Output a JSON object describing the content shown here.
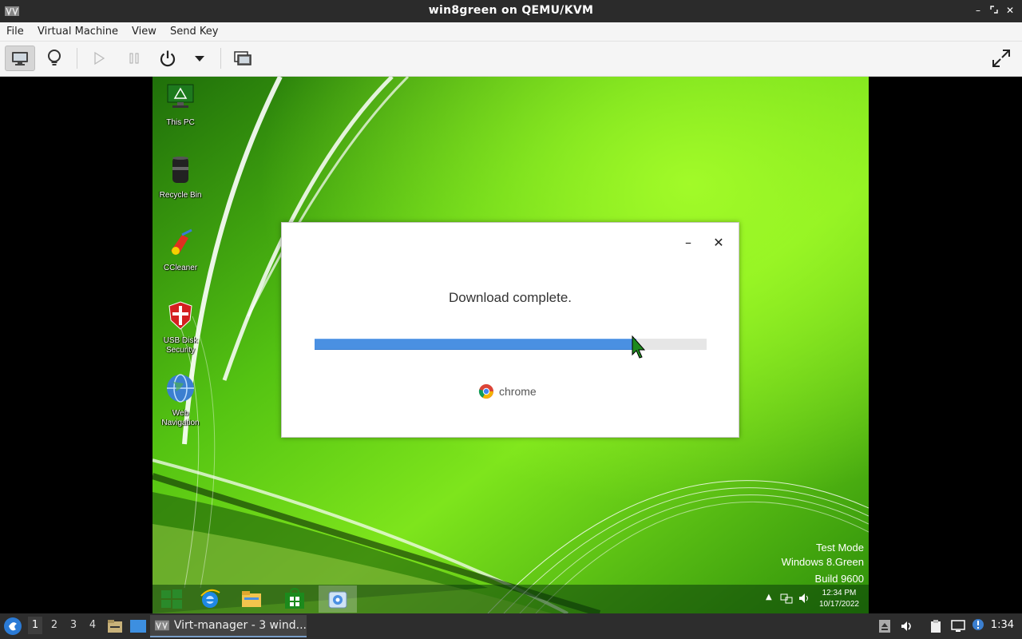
{
  "window": {
    "title": "win8green on QEMU/KVM"
  },
  "menubar": {
    "items": [
      "File",
      "Virtual Machine",
      "View",
      "Send Key"
    ]
  },
  "toolbar": {
    "buttons": [
      "console-view",
      "details-view",
      "run",
      "pause",
      "shutdown",
      "shutdown-menu",
      "snapshots",
      "fullscreen"
    ]
  },
  "desktop": {
    "icons": [
      {
        "label": "This PC",
        "icon": "monitor-icon"
      },
      {
        "label": "Recycle Bin",
        "icon": "recycle-bin-icon"
      },
      {
        "label": "CCleaner",
        "icon": "ccleaner-icon"
      },
      {
        "label": "USB Disk Security",
        "icon": "shield-icon"
      },
      {
        "label": "Web Navigation",
        "icon": "globe-icon"
      }
    ],
    "watermark": {
      "line1": "Test Mode",
      "line2": "Windows 8.Green",
      "line3": "Build 9600"
    }
  },
  "dialog": {
    "message": "Download complete.",
    "progress_fraction": 0.82,
    "brand": "chrome",
    "minimize_glyph": "–",
    "close_glyph": "✕"
  },
  "guest_taskbar": {
    "apps": [
      "start-icon",
      "internet-explorer-icon",
      "file-explorer-icon",
      "store-icon",
      "setup-icon"
    ],
    "tray_arrow": "▲",
    "clock_time": "12:34 PM",
    "clock_date": "10/17/2022"
  },
  "host_taskbar": {
    "workspaces": [
      "1",
      "2",
      "3",
      "4"
    ],
    "app_label": "Virt-manager - 3 wind...",
    "clock": "1:34"
  },
  "colors": {
    "progress": "#4a90e2",
    "wallpaper": "#36a011"
  }
}
